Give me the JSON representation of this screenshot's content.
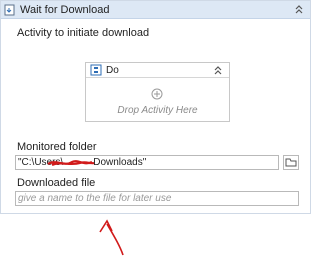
{
  "activity": {
    "title": "Wait for Download",
    "trigger_label": "Activity to initiate download"
  },
  "do_container": {
    "title": "Do",
    "drop_hint": "Drop Activity Here"
  },
  "monitored_folder": {
    "label": "Monitored folder",
    "value": "\"C:\\Users\\",
    "value_suffix": "Downloads\""
  },
  "downloaded_file": {
    "label": "Downloaded file",
    "placeholder": "give a name to the file for later use"
  },
  "colors": {
    "header_bg": "#dde8f5",
    "annotation_red": "#d11a1a"
  },
  "icons": {
    "activity": "download-activity-icon",
    "collapse": "chevron-up-double-icon",
    "do": "sequence-icon",
    "add": "add-circle-icon",
    "browse": "folder-icon"
  }
}
